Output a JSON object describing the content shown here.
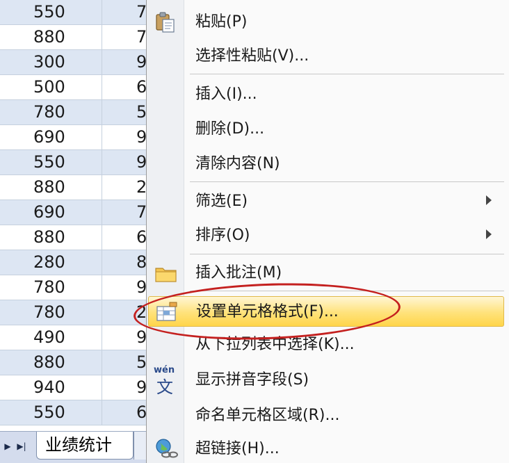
{
  "sheet": {
    "rows": [
      {
        "a": "550",
        "b": "7"
      },
      {
        "a": "880",
        "b": "7"
      },
      {
        "a": "300",
        "b": "9"
      },
      {
        "a": "500",
        "b": "6"
      },
      {
        "a": "780",
        "b": "5"
      },
      {
        "a": "690",
        "b": "9"
      },
      {
        "a": "550",
        "b": "9"
      },
      {
        "a": "880",
        "b": "2"
      },
      {
        "a": "690",
        "b": "7"
      },
      {
        "a": "880",
        "b": "6"
      },
      {
        "a": "280",
        "b": "8"
      },
      {
        "a": "780",
        "b": "9"
      },
      {
        "a": "780",
        "b": "2"
      },
      {
        "a": "490",
        "b": "9"
      },
      {
        "a": "880",
        "b": "5"
      },
      {
        "a": "940",
        "b": "9"
      },
      {
        "a": "550",
        "b": "6"
      }
    ],
    "tab_bar": {
      "nav_next": "▶",
      "nav_last": "▶|",
      "sheet_tab_label": "业绩统计"
    }
  },
  "menu": {
    "items": [
      {
        "label": "粘贴(P)",
        "icon": "paste-icon"
      },
      {
        "label": "选择性粘贴(V)..."
      },
      {
        "label": "插入(I)..."
      },
      {
        "label": "删除(D)..."
      },
      {
        "label": "清除内容(N)"
      },
      {
        "label": "筛选(E)",
        "submenu": true
      },
      {
        "label": "排序(O)",
        "submenu": true
      },
      {
        "label": "插入批注(M)",
        "icon": "comment-folder-icon"
      },
      {
        "label": "设置单元格格式(F)...",
        "icon": "format-cells-icon",
        "highlighted": true
      },
      {
        "label": "从下拉列表中选择(K)..."
      },
      {
        "label": "显示拼音字段(S)",
        "icon": "phonetic-wen-icon",
        "icon_text": "wén",
        "icon_char": "文"
      },
      {
        "label": "命名单元格区域(R)..."
      },
      {
        "label": "超链接(H)...",
        "icon": "hyperlink-globe-icon"
      }
    ]
  },
  "colors": {
    "row_alt": "#dde6f3",
    "highlight": "#ffe27a",
    "annotation": "#c4201f"
  }
}
